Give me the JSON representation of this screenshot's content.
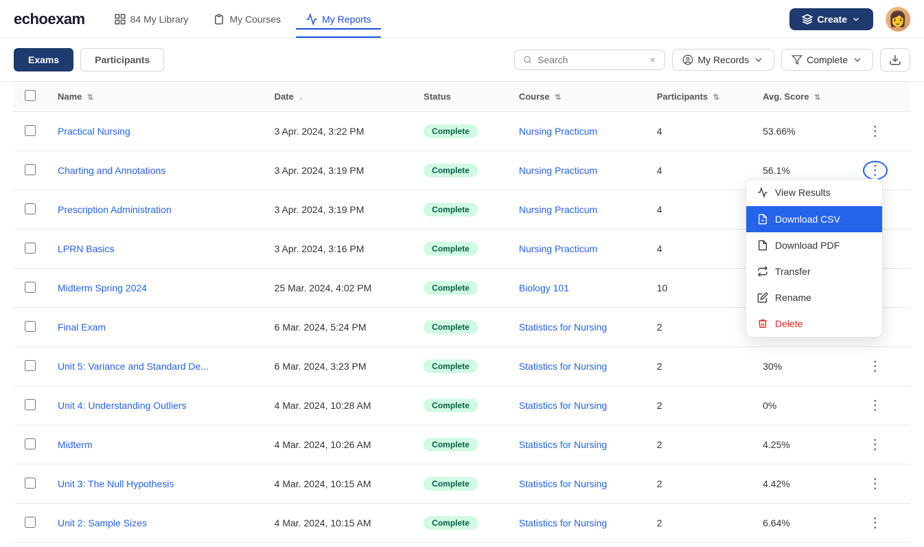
{
  "nav": {
    "logo": "echoexam",
    "items": [
      {
        "id": "library",
        "label": "84 My Library",
        "active": false
      },
      {
        "id": "courses",
        "label": "My Courses",
        "active": false
      },
      {
        "id": "reports",
        "label": "My Reports",
        "active": true
      }
    ],
    "create_label": "Create",
    "avatar_emoji": "👩"
  },
  "toolbar": {
    "tab_exams": "Exams",
    "tab_participants": "Participants",
    "search_placeholder": "Search",
    "filter_records": "My Records",
    "filter_complete": "Complete",
    "download_title": "Download"
  },
  "table": {
    "headers": [
      {
        "id": "name",
        "label": "Name",
        "sort": "↕"
      },
      {
        "id": "date",
        "label": "Date",
        "sort": "↓"
      },
      {
        "id": "status",
        "label": "Status",
        "sort": ""
      },
      {
        "id": "course",
        "label": "Course",
        "sort": "↕"
      },
      {
        "id": "participants",
        "label": "Participants",
        "sort": "↕"
      },
      {
        "id": "avg_score",
        "label": "Avg. Score",
        "sort": "↕"
      }
    ],
    "rows": [
      {
        "name": "Practical Nursing",
        "date": "3 Apr. 2024, 3:22 PM",
        "status": "Complete",
        "course": "Nursing Practicum",
        "participants": "4",
        "avg_score": "53.66%",
        "menu_open": false
      },
      {
        "name": "Charting and Annotations",
        "date": "3 Apr. 2024, 3:19 PM",
        "status": "Complete",
        "course": "Nursing Practicum",
        "participants": "4",
        "avg_score": "56.1%",
        "menu_open": true
      },
      {
        "name": "Prescription Administration",
        "date": "3 Apr. 2024, 3:19 PM",
        "status": "Complete",
        "course": "Nursing Practicum",
        "participants": "4",
        "avg_score": "",
        "menu_open": false
      },
      {
        "name": "LPRN Basics",
        "date": "3 Apr. 2024, 3:16 PM",
        "status": "Complete",
        "course": "Nursing Practicum",
        "participants": "4",
        "avg_score": "",
        "menu_open": false
      },
      {
        "name": "Midterm Spring 2024",
        "date": "25 Mar. 2024, 4:02 PM",
        "status": "Complete",
        "course": "Biology 101",
        "participants": "10",
        "avg_score": "",
        "menu_open": false
      },
      {
        "name": "Final Exam",
        "date": "6 Mar. 2024, 5:24 PM",
        "status": "Complete",
        "course": "Statistics for Nursing",
        "participants": "2",
        "avg_score": "",
        "menu_open": false
      },
      {
        "name": "Unit 5: Variance and Standard De...",
        "date": "6 Mar. 2024, 3:23 PM",
        "status": "Complete",
        "course": "Statistics for Nursing",
        "participants": "2",
        "avg_score": "30%",
        "menu_open": false
      },
      {
        "name": "Unit 4: Understanding Outliers",
        "date": "4 Mar. 2024, 10:28 AM",
        "status": "Complete",
        "course": "Statistics for Nursing",
        "participants": "2",
        "avg_score": "0%",
        "menu_open": false
      },
      {
        "name": "Midterm",
        "date": "4 Mar. 2024, 10:26 AM",
        "status": "Complete",
        "course": "Statistics for Nursing",
        "participants": "2",
        "avg_score": "4.25%",
        "menu_open": false
      },
      {
        "name": "Unit 3: The Null Hypothesis",
        "date": "4 Mar. 2024, 10:15 AM",
        "status": "Complete",
        "course": "Statistics for Nursing",
        "participants": "2",
        "avg_score": "4.42%",
        "menu_open": false
      },
      {
        "name": "Unit 2: Sample Sizes",
        "date": "4 Mar. 2024, 10:15 AM",
        "status": "Complete",
        "course": "Statistics for Nursing",
        "participants": "2",
        "avg_score": "6.64%",
        "menu_open": false
      }
    ]
  },
  "context_menu": {
    "items": [
      {
        "id": "view-results",
        "label": "View Results",
        "icon": "chart",
        "danger": false,
        "highlight": false
      },
      {
        "id": "download-csv",
        "label": "Download CSV",
        "icon": "csv",
        "danger": false,
        "highlight": true
      },
      {
        "id": "download-pdf",
        "label": "Download PDF",
        "icon": "pdf",
        "danger": false,
        "highlight": false
      },
      {
        "id": "transfer",
        "label": "Transfer",
        "icon": "transfer",
        "danger": false,
        "highlight": false
      },
      {
        "id": "rename",
        "label": "Rename",
        "icon": "rename",
        "danger": false,
        "highlight": false
      },
      {
        "id": "delete",
        "label": "Delete",
        "icon": "trash",
        "danger": true,
        "highlight": false
      }
    ]
  }
}
